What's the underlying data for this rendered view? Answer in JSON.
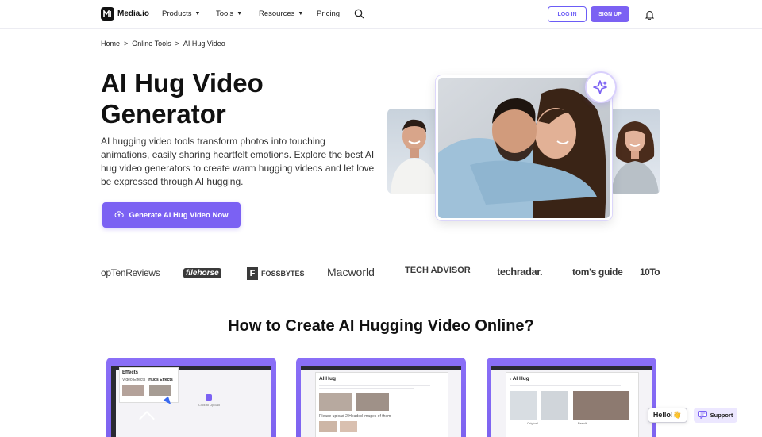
{
  "nav": {
    "brand": "Media.io",
    "items": [
      "Products",
      "Tools",
      "Resources",
      "Pricing"
    ],
    "login_label": "LOG IN",
    "signup_label": "SIGN UP"
  },
  "breadcrumb": [
    "Home",
    ">",
    "Online Tools",
    ">",
    "AI Hug Video"
  ],
  "hero": {
    "title": "AI Hug Video Generator",
    "description": "AI hugging video tools transform photos into touching animations, easily sharing heartfelt emotions. Explore the best AI hug video generators to create warm hugging videos and let love be expressed through AI hugging.",
    "cta_label": "Generate AI Hug Video Now"
  },
  "press_logos": [
    "opTenReviews",
    "filehorse",
    "FOSSBYTES",
    "Macworld",
    "TECH ADVISOR",
    "techradar.",
    "tom's guide",
    "10To"
  ],
  "how_to": {
    "title": "How to Create AI Hugging Video Online?",
    "steps": [
      {
        "panel_title": "Effects",
        "tabs": [
          "Video Effects",
          "Hugs Effects"
        ],
        "upload_text": "Click to Upload"
      },
      {
        "panel_title": "AI Hug",
        "note": "Please upload 2 Headed images of them"
      },
      {
        "panel_title": "AI Hug",
        "labels": [
          "Original",
          "Result"
        ]
      }
    ]
  },
  "widgets": {
    "hello_label": "Hello!👋",
    "support_label": "Support"
  },
  "colors": {
    "accent": "#7b61f3"
  }
}
